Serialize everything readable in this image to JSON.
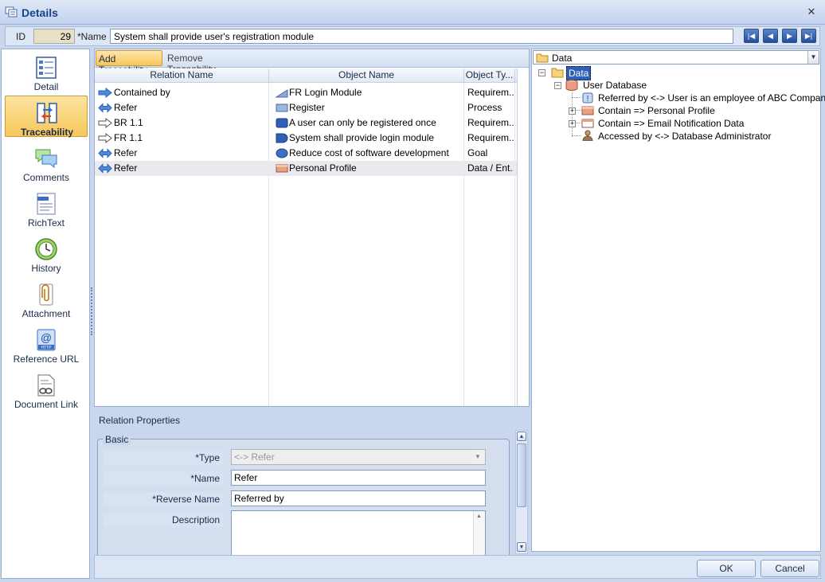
{
  "window": {
    "title": "Details"
  },
  "record": {
    "id_label": "ID",
    "id_value": "29",
    "name_label": "*Name",
    "name_value": "System shall provide user's registration module"
  },
  "sidebar": {
    "items": [
      {
        "label": "Detail",
        "icon": "detail-icon"
      },
      {
        "label": "Traceability",
        "icon": "traceability-icon",
        "active": true
      },
      {
        "label": "Comments",
        "icon": "comments-icon"
      },
      {
        "label": "RichText",
        "icon": "richtext-icon"
      },
      {
        "label": "History",
        "icon": "history-icon"
      },
      {
        "label": "Attachment",
        "icon": "attachment-icon"
      },
      {
        "label": "Reference URL",
        "icon": "reference-url-icon"
      },
      {
        "label": "Document Link",
        "icon": "document-link-icon"
      }
    ]
  },
  "toolbar": {
    "add_label": "Add Traceability",
    "remove_label": "Remove Traceability"
  },
  "grid": {
    "columns": [
      "Relation Name",
      "Object Name",
      "Object Ty..."
    ],
    "rows": [
      {
        "relation": "Contained by",
        "object": "FR Login Module",
        "type": "Requirem...",
        "rel_icon": "arrow-right-blue",
        "obj_icon": "module-icon"
      },
      {
        "relation": "Refer",
        "object": "Register",
        "type": "Process",
        "rel_icon": "arrow-both-blue",
        "obj_icon": "process-icon"
      },
      {
        "relation": "BR 1.1",
        "object": "A user can only be registered once",
        "type": "Requirem...",
        "rel_icon": "arrow-right-outline",
        "obj_icon": "requirement-icon"
      },
      {
        "relation": "FR 1.1",
        "object": "System shall provide login module",
        "type": "Requirem...",
        "rel_icon": "arrow-right-outline",
        "obj_icon": "requirement-icon"
      },
      {
        "relation": "Refer",
        "object": "Reduce cost of software development",
        "type": "Goal",
        "rel_icon": "arrow-both-blue",
        "obj_icon": "goal-icon"
      },
      {
        "relation": "Refer",
        "object": "Personal Profile",
        "type": "Data / Ent...",
        "rel_icon": "arrow-both-blue",
        "obj_icon": "entity-icon",
        "selected": true
      }
    ]
  },
  "properties": {
    "title": "Relation Properties",
    "group": "Basic",
    "type_label": "*Type",
    "type_value": "<-> Refer",
    "name_label": "*Name",
    "name_value": "Refer",
    "reverse_label": "*Reverse Name",
    "reverse_value": "Referred by",
    "description_label": "Description",
    "description_value": ""
  },
  "tree": {
    "combo_value": "Data",
    "root": "Data",
    "child": "User Database",
    "leaves": [
      "Referred by <-> User is an employee of ABC Company",
      "Contain => Personal Profile",
      "Contain => Email Notification Data",
      "Accessed by <-> Database Administrator"
    ]
  },
  "footer": {
    "ok": "OK",
    "cancel": "Cancel"
  },
  "colors": {
    "accent": "#15428b",
    "selected_tab": "#f6c85b",
    "tree_selected": "#2f5fb6"
  }
}
